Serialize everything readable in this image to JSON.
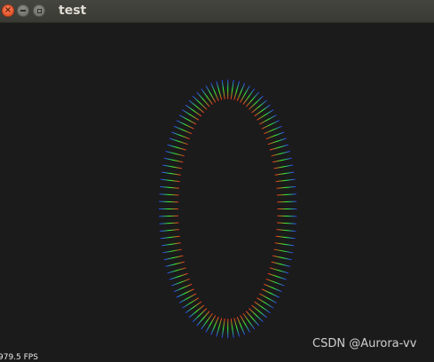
{
  "window": {
    "title": "test",
    "close_glyph": "×",
    "close_icon": "close-icon",
    "minimize_icon": "minimize-icon",
    "maximize_icon": "maximize-icon"
  },
  "scene": {
    "ellipse_center": [
      0.525,
      0.58
    ],
    "ellipse_radii": [
      0.114,
      0.305
    ],
    "line_count": 100,
    "colors": {
      "inner": "#ff2a1a",
      "middle": "#33ff33",
      "outer": "#2a3aff"
    }
  },
  "overlay": {
    "fps": "979.5 FPS",
    "watermark": "CSDN @Aurora-vv"
  }
}
